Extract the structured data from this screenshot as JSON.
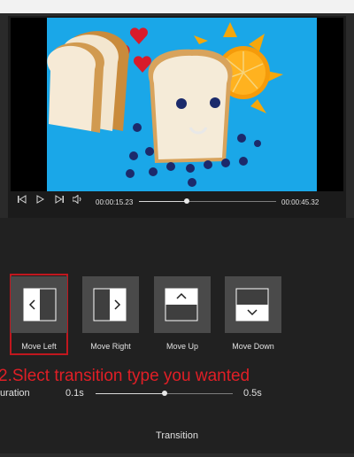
{
  "player": {
    "current_time": "00:00:15.23",
    "total_time": "00:00:45.32",
    "progress": 0.35,
    "controls": [
      "skip-back-icon",
      "play-icon",
      "skip-forward-icon",
      "volume-icon"
    ]
  },
  "transitions": {
    "items": [
      {
        "label": "Move Left",
        "icon": "move-left-icon",
        "selected": true
      },
      {
        "label": "Move Right",
        "icon": "move-right-icon",
        "selected": false
      },
      {
        "label": "Move Up",
        "icon": "move-up-icon",
        "selected": false
      },
      {
        "label": "Move Down",
        "icon": "move-down-icon",
        "selected": false
      }
    ]
  },
  "annotation": "2.Slect transition type you wanted",
  "duration": {
    "label": "uration",
    "min_label": "0.1s",
    "max_label": "0.5s",
    "value_fraction": 0.5
  },
  "footer": {
    "title": "Transition"
  },
  "colors": {
    "accent_red": "#e01f26",
    "selection_border": "#c0171e",
    "video_background": "#1aa7e8"
  }
}
